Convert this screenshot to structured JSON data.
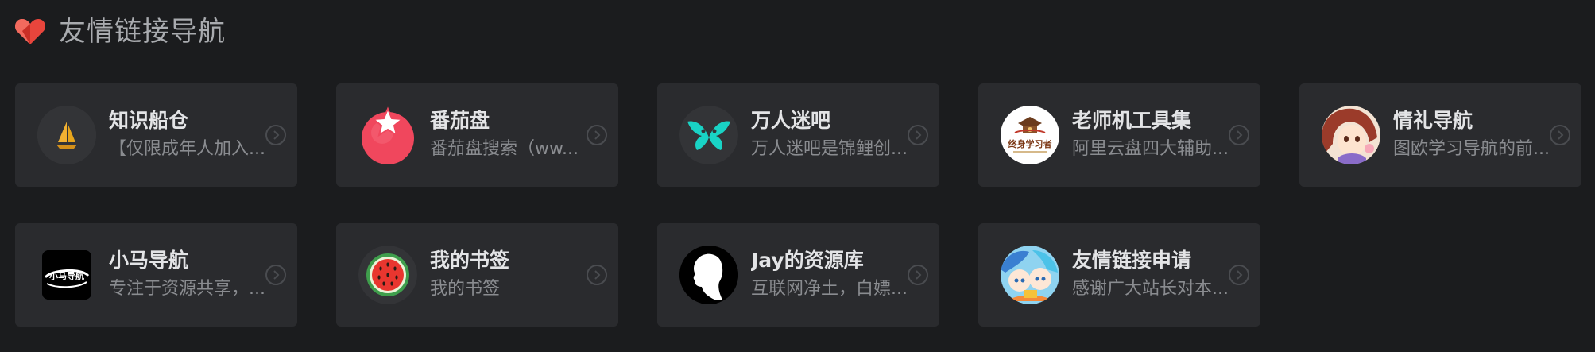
{
  "section": {
    "title": "友情链接导航",
    "icon": "heart-icon"
  },
  "colors": {
    "background": "#1b1c1e",
    "card": "#2a2b2e",
    "heart": "#e8453c",
    "title_text": "#e3e4e6",
    "desc_text": "#8a8c90"
  },
  "cards": [
    {
      "title": "知识船仓",
      "desc": "【仅限成年人加入...",
      "icon": "sailboat-icon"
    },
    {
      "title": "番茄盘",
      "desc": "番茄盘搜索（ww...",
      "icon": "tomato-icon"
    },
    {
      "title": "万人迷吧",
      "desc": "万人迷吧是锦鲤创...",
      "icon": "butterfly-icon"
    },
    {
      "title": "老师机工具集",
      "desc": "阿里云盘四大辅助...",
      "icon": "lifelong-learning-logo-icon",
      "logo_text": "终身学习者"
    },
    {
      "title": "情礼导航",
      "desc": "图欧学习导航的前...",
      "icon": "anime-avatar-icon"
    },
    {
      "title": "小马导航",
      "desc": "专注于资源共享，...",
      "icon": "xiaoma-logo-icon",
      "logo_text": "小马导航"
    },
    {
      "title": "我的书签",
      "desc": "我的书签",
      "icon": "watermelon-icon"
    },
    {
      "title": "Jay的资源库",
      "desc": "互联网净土，白嫖...",
      "icon": "silhouette-icon"
    },
    {
      "title": "友情链接申请",
      "desc": "感谢广大站长对本...",
      "icon": "anime-group-icon"
    }
  ]
}
